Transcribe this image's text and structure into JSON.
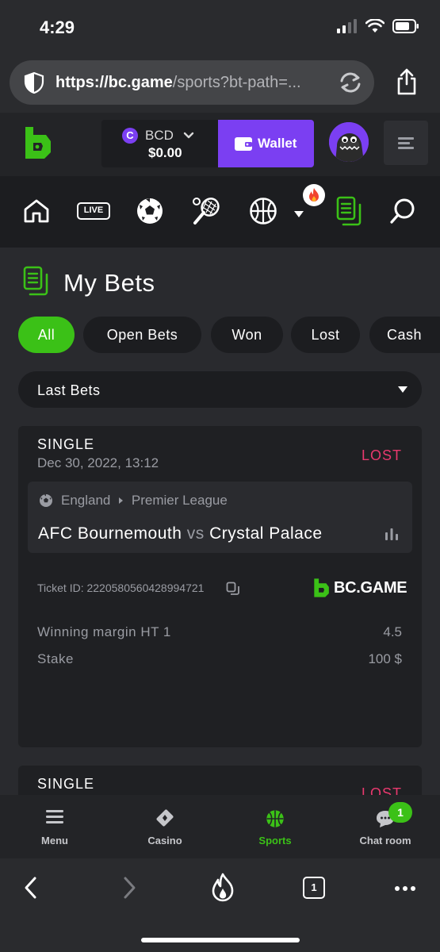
{
  "status_bar": {
    "time": "4:29"
  },
  "browser": {
    "url_host": "https://bc.game",
    "url_path": "/sports?bt-path=..."
  },
  "header": {
    "currency_code": "BCD",
    "currency_glyph": "C",
    "balance": "$0.00",
    "wallet_label": "Wallet"
  },
  "sports_nav": {
    "live_label": "LIVE",
    "icons": [
      "home-icon",
      "live-icon",
      "soccer-icon",
      "tennis-icon",
      "basketball-icon",
      "more-chevron-icon",
      "fire-icon",
      "betslip-icon",
      "search-icon"
    ]
  },
  "page": {
    "title": "My Bets"
  },
  "filters": {
    "all": "All",
    "open": "Open Bets",
    "won": "Won",
    "lost": "Lost",
    "cash": "Cash"
  },
  "dropdown": {
    "selected": "Last Bets"
  },
  "bets": [
    {
      "type": "SINGLE",
      "date": "Dec 30, 2022, 13:12",
      "result": "LOST",
      "country": "England",
      "league": "Premier League",
      "home": "AFC Bournemouth",
      "vs": "vs",
      "away": "Crystal Palace",
      "ticket": "Ticket ID: 2220580560428994721",
      "brand": "BC.GAME",
      "market_label": "Winning margin HT 1",
      "market_value": "4.5",
      "stake_label": "Stake",
      "stake_value": "100 $"
    },
    {
      "type": "SINGLE",
      "result": "LOST"
    }
  ],
  "tabbar": {
    "menu": "Menu",
    "casino": "Casino",
    "sports": "Sports",
    "chat": "Chat room",
    "chat_badge": "1"
  },
  "safari": {
    "tabs_count": "1"
  },
  "colors": {
    "accent_green": "#3bc117",
    "wallet_purple": "#7b3ff2",
    "lost_pink": "#e8396e",
    "background": "#1c1d20"
  }
}
